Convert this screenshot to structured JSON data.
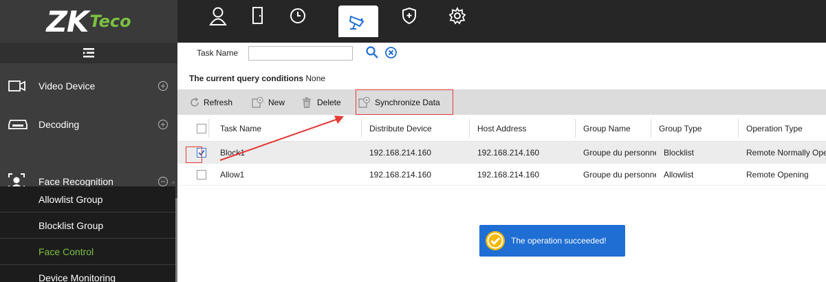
{
  "brand": {
    "logo_main": "ZK",
    "logo_suffix": "Teco",
    "accent": "#7bc043"
  },
  "modules": [
    {
      "icon": "person-icon",
      "name": "personnel"
    },
    {
      "icon": "door-icon",
      "name": "access"
    },
    {
      "icon": "clock-icon",
      "name": "attendance"
    },
    {
      "icon": "camera-icon",
      "name": "video",
      "active": true
    },
    {
      "icon": "shield-icon",
      "name": "security"
    },
    {
      "icon": "gear-icon",
      "name": "system"
    }
  ],
  "sidebar": {
    "groups": [
      {
        "label": "Video Device",
        "expanded": false
      },
      {
        "label": "Decoding",
        "expanded": false
      },
      {
        "label": "Face Recognition",
        "expanded": true
      }
    ],
    "sub_items": [
      {
        "label": "Allowlist Group",
        "active": false
      },
      {
        "label": "Blocklist Group",
        "active": false
      },
      {
        "label": "Face Control",
        "active": true
      },
      {
        "label": "Device Monitoring",
        "active": false
      }
    ]
  },
  "search": {
    "label": "Task Name",
    "value": ""
  },
  "query": {
    "prefix": "The current query conditions",
    "value": "None"
  },
  "toolbar": {
    "refresh": "Refresh",
    "new": "New",
    "delete": "Delete",
    "sync": "Synchronize Data"
  },
  "table": {
    "columns": [
      "Task Name",
      "Distribute Device",
      "Host Address",
      "Group Name",
      "Group Type",
      "Operation Type"
    ],
    "rows": [
      {
        "task": "Block1",
        "device": "192.168.214.160",
        "host": "192.168.214.160",
        "group": "Groupe du personnel",
        "type": "Blocklist",
        "operation": "Remote Normally Open",
        "checked": true
      },
      {
        "task": "Allow1",
        "device": "192.168.214.160",
        "host": "192.168.214.160",
        "group": "Groupe du personnel",
        "type": "Allowlist",
        "operation": "Remote Opening",
        "checked": false
      }
    ]
  },
  "toast": {
    "message": "The operation succeeded!",
    "color": "#1f6ed4"
  },
  "annotation_color": "#e53935"
}
